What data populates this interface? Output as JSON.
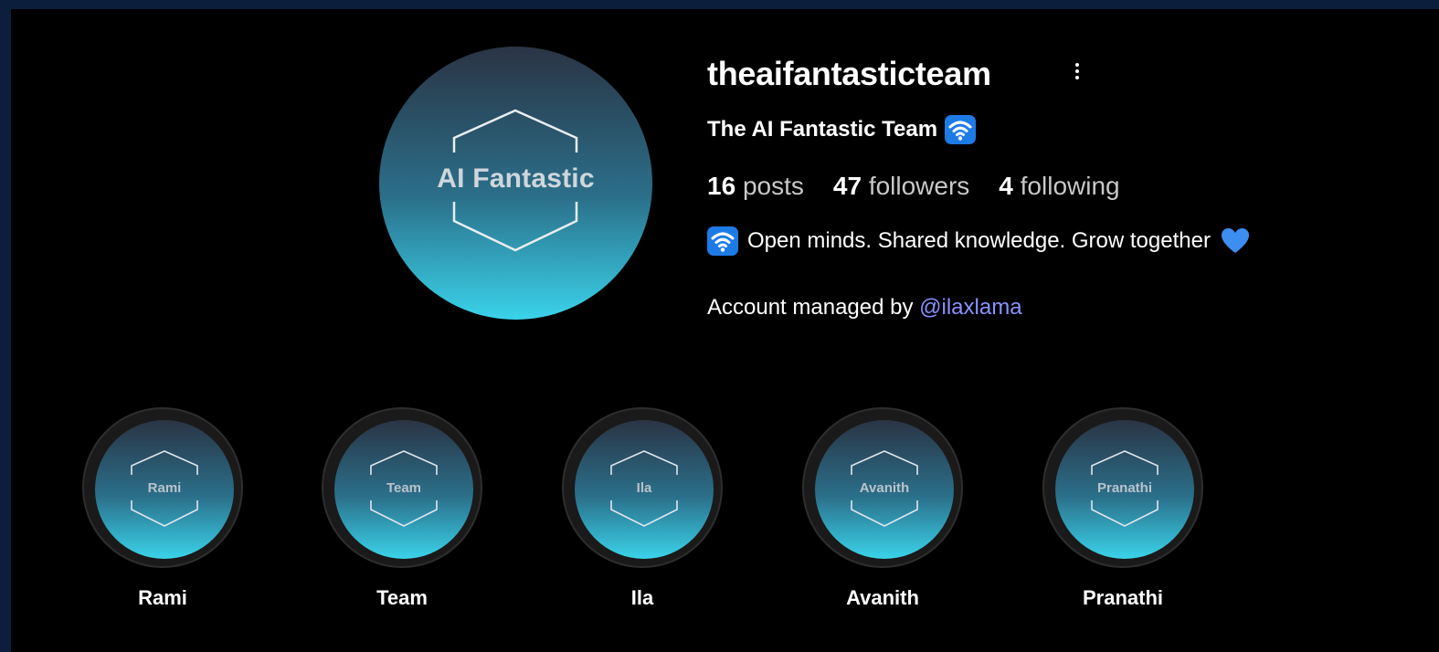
{
  "profile": {
    "avatar_text": "AI Fantastic",
    "username": "theaifantasticteam",
    "full_name": "The AI Fantastic Team",
    "stats": {
      "posts_count": "16",
      "posts_label": "posts",
      "followers_count": "47",
      "followers_label": "followers",
      "following_count": "4",
      "following_label": "following"
    },
    "bio": "Open minds. Shared knowledge. Grow together",
    "managed_prefix": "Account managed by",
    "managed_handle": "@ilaxlama",
    "icons": {
      "more": "more-vertical-icon",
      "wifi": "wifi-emoji-icon",
      "heart": "blue-heart-icon"
    },
    "colors": {
      "link": "#8a92ff",
      "accent_blue": "#1d7be6"
    }
  },
  "highlights": [
    {
      "cover_text": "Rami",
      "label": "Rami"
    },
    {
      "cover_text": "Team",
      "label": "Team"
    },
    {
      "cover_text": "Ila",
      "label": "Ila"
    },
    {
      "cover_text": "Avanith",
      "label": "Avanith"
    },
    {
      "cover_text": "Pranathi",
      "label": "Pranathi"
    }
  ]
}
